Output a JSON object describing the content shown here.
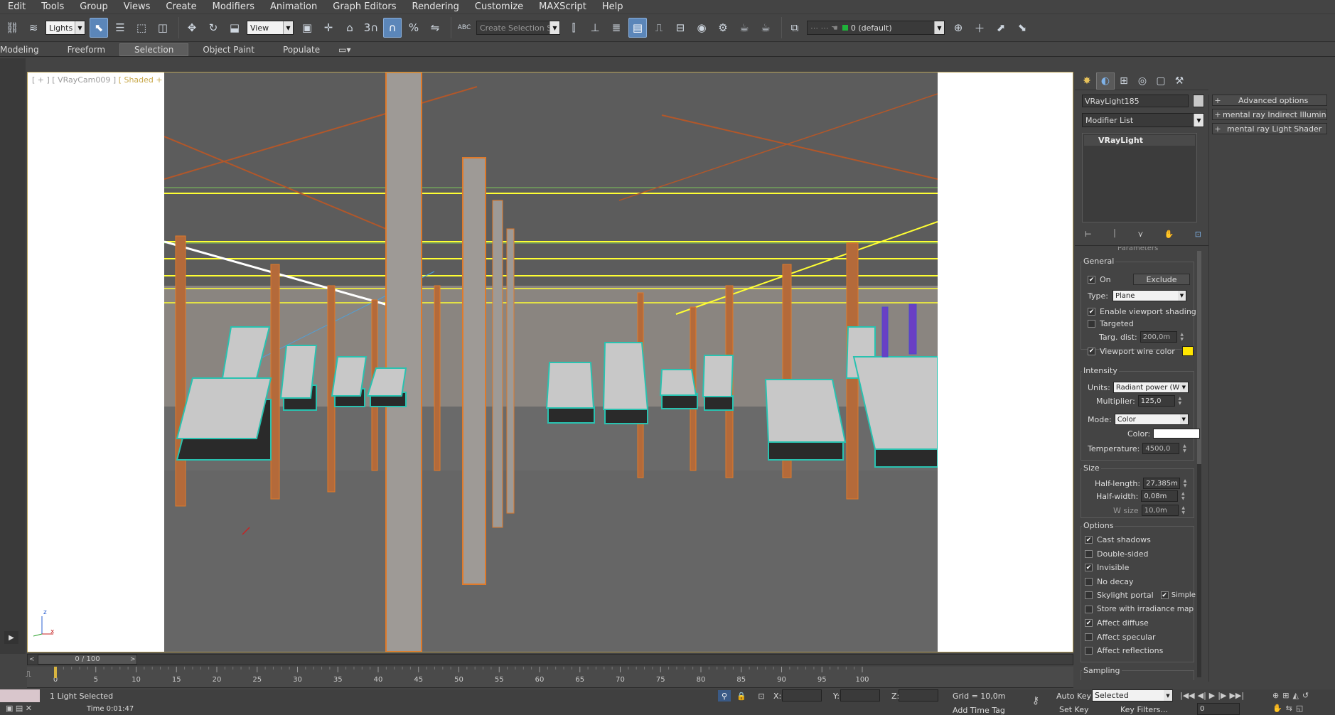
{
  "menu": [
    "Edit",
    "Tools",
    "Group",
    "Views",
    "Create",
    "Modifiers",
    "Animation",
    "Graph Editors",
    "Rendering",
    "Customize",
    "MAXScript",
    "Help"
  ],
  "toolbar": {
    "filter_value": "Lights",
    "refcoord_value": "View",
    "selection_set_placeholder": "Create Selection Se",
    "layer_value": "0 (default)",
    "snap_label": "3",
    "abc_label": "ABC"
  },
  "ribbon_tabs": [
    {
      "label": "Modeling",
      "active": false
    },
    {
      "label": "Freeform",
      "active": false
    },
    {
      "label": "Selection",
      "active": true
    },
    {
      "label": "Object Paint",
      "active": false
    },
    {
      "label": "Populate",
      "active": false
    }
  ],
  "viewport": {
    "label_prefix": "[ + ] [ VRayCam009 ]",
    "label_mode": "[ Shaded + Edged Faces ]",
    "axis_z": "z",
    "axis_x": "x"
  },
  "command_panel": {
    "object_name": "VRayLight185",
    "modifier_list_label": "Modifier List",
    "stack_item": "VRayLight",
    "rollout_header": "Parameters",
    "general": {
      "title": "General",
      "on_label": "On",
      "on_checked": true,
      "exclude_label": "Exclude",
      "type_label": "Type:",
      "type_value": "Plane",
      "viewport_shading_label": "Enable viewport shading",
      "viewport_shading_checked": true,
      "targeted_label": "Targeted",
      "targeted_checked": false,
      "targ_dist_label": "Targ. dist:",
      "targ_dist_value": "200,0m",
      "wire_color_label": "Viewport wire color",
      "wire_color_checked": true,
      "wire_color": "#ffe600"
    },
    "intensity": {
      "title": "Intensity",
      "units_label": "Units:",
      "units_value": "Radiant power (W",
      "multiplier_label": "Multiplier:",
      "multiplier_value": "125,0",
      "mode_label": "Mode:",
      "mode_value": "Color",
      "color_label": "Color:",
      "color_value": "#ffffff",
      "temperature_label": "Temperature:",
      "temperature_value": "4500,0"
    },
    "size": {
      "title": "Size",
      "half_length_label": "Half-length:",
      "half_length_value": "27,385m",
      "half_width_label": "Half-width:",
      "half_width_value": "0,08m",
      "w_size_label": "W size",
      "w_size_value": "10,0m"
    },
    "options": {
      "title": "Options",
      "items": [
        {
          "label": "Cast shadows",
          "checked": true
        },
        {
          "label": "Double-sided",
          "checked": false
        },
        {
          "label": "Invisible",
          "checked": true
        },
        {
          "label": "No decay",
          "checked": false
        },
        {
          "label": "Skylight portal",
          "checked": false
        },
        {
          "label": "Store with irradiance map",
          "checked": false
        },
        {
          "label": "Affect diffuse",
          "checked": true
        },
        {
          "label": "Affect specular",
          "checked": false
        },
        {
          "label": "Affect reflections",
          "checked": false
        }
      ],
      "simple_label": "Simple",
      "simple_checked": true
    },
    "sampling_title": "Sampling"
  },
  "rollouts": [
    "Advanced options",
    "mental ray Indirect Illumination",
    "mental ray Light Shader"
  ],
  "timeline": {
    "time_value": "0 / 100",
    "ticks": [
      0,
      5,
      10,
      15,
      20,
      25,
      30,
      35,
      40,
      45,
      50,
      55,
      60,
      65,
      70,
      75,
      80,
      85,
      90,
      95,
      100
    ]
  },
  "status": {
    "selection_text": "1 Light Selected",
    "time_text": "Time  0:01:47",
    "x_label": "X:",
    "y_label": "Y:",
    "z_label": "Z:",
    "grid_text": "Grid = 10,0m",
    "auto_key": "Auto Key",
    "set_key": "Set Key",
    "selected_value": "Selected",
    "key_filters": "Key Filters...",
    "add_time_tag": "Add Time Tag",
    "frame_value": "0"
  }
}
